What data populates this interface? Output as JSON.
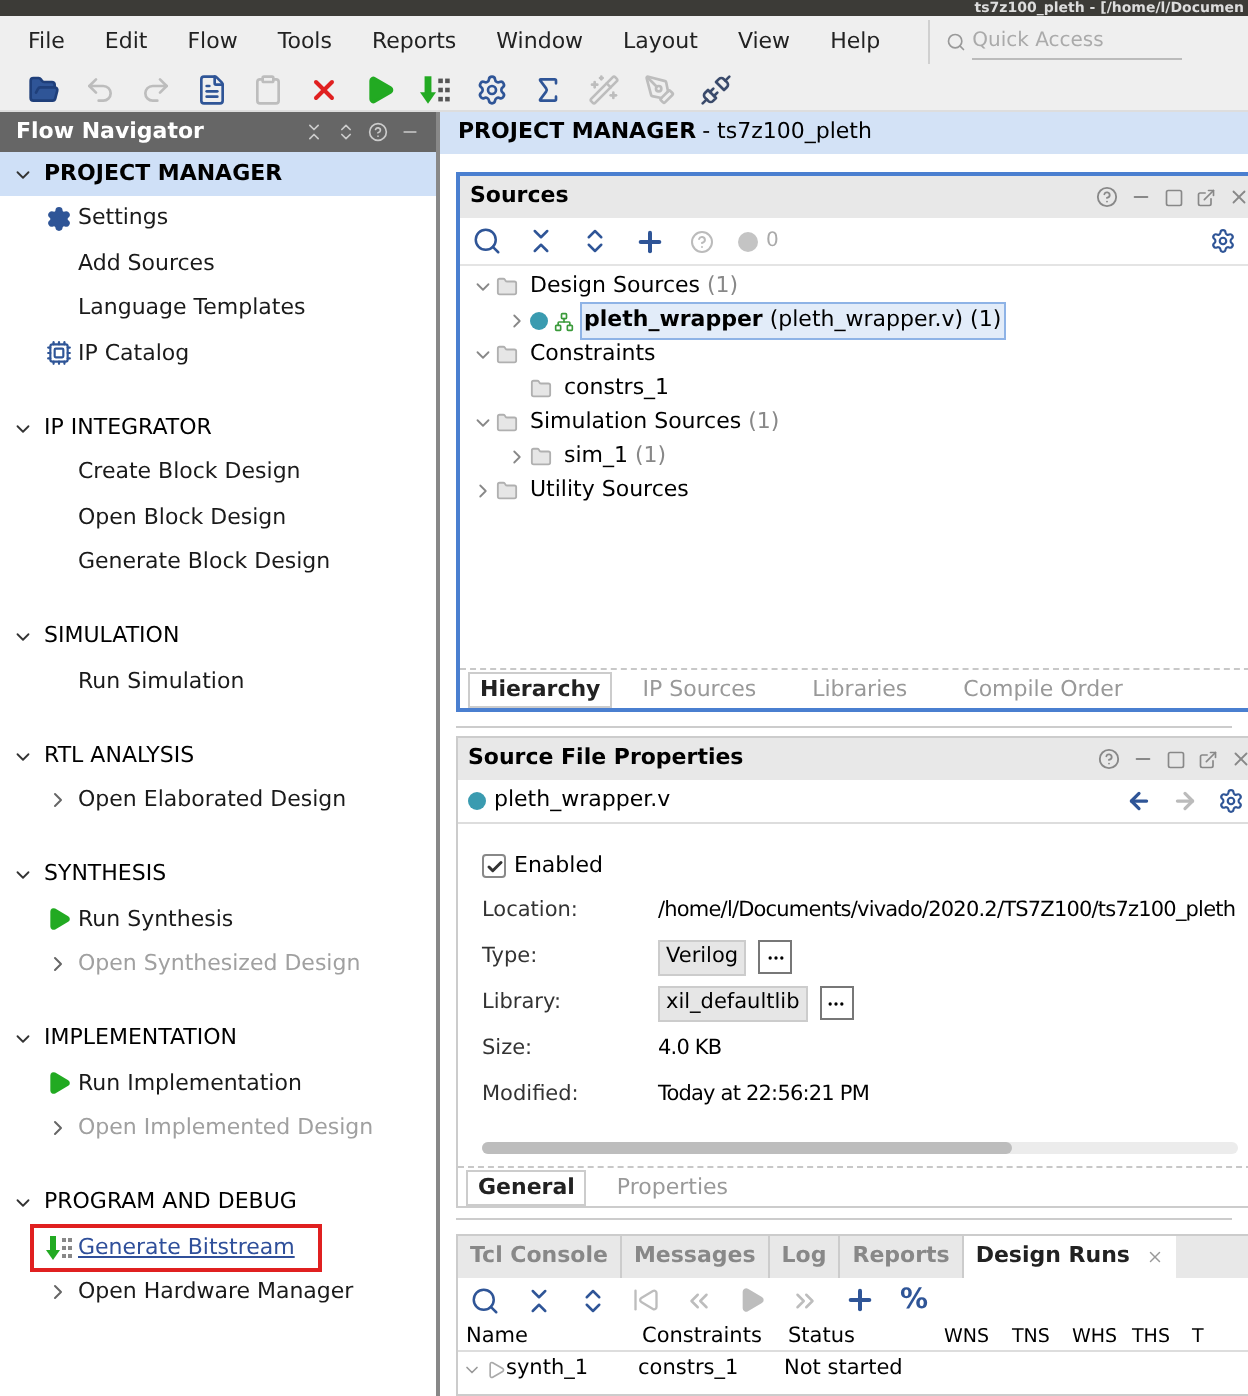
{
  "window": {
    "title": "ts7z100_pleth - [/home/l/Documen"
  },
  "menu": [
    "File",
    "Edit",
    "Flow",
    "Tools",
    "Reports",
    "Window",
    "Layout",
    "View",
    "Help"
  ],
  "quick_access": {
    "placeholder": "Quick Access"
  },
  "toolbar": [
    {
      "kind": "open",
      "disabled": false
    },
    {
      "kind": "undo",
      "disabled": true
    },
    {
      "kind": "redo",
      "disabled": true
    },
    {
      "kind": "report",
      "disabled": false
    },
    {
      "kind": "paste",
      "disabled": true
    },
    {
      "kind": "cancel",
      "disabled": false
    },
    {
      "kind": "run",
      "disabled": false
    },
    {
      "kind": "bitstream",
      "disabled": false
    },
    {
      "kind": "settings",
      "disabled": false
    },
    {
      "kind": "sigma",
      "disabled": false
    },
    {
      "kind": "wand",
      "disabled": true
    },
    {
      "kind": "pen",
      "disabled": true
    },
    {
      "kind": "unplug",
      "disabled": false
    }
  ],
  "flow_navigator": {
    "title": "Flow Navigator",
    "sections": [
      {
        "title": "PROJECT MANAGER",
        "selected": true,
        "items": [
          {
            "label": "Settings",
            "kind": "gear",
            "disabled": false
          },
          {
            "label": "Add Sources",
            "kind": "plain",
            "disabled": false
          },
          {
            "label": "Language Templates",
            "kind": "plain",
            "disabled": false
          },
          {
            "label": "IP Catalog",
            "kind": "chip",
            "disabled": false
          }
        ]
      },
      {
        "title": "IP INTEGRATOR",
        "selected": false,
        "items": [
          {
            "label": "Create Block Design",
            "kind": "plain",
            "disabled": false
          },
          {
            "label": "Open Block Design",
            "kind": "plain",
            "disabled": false
          },
          {
            "label": "Generate Block Design",
            "kind": "plain",
            "disabled": false
          }
        ]
      },
      {
        "title": "SIMULATION",
        "selected": false,
        "items": [
          {
            "label": "Run Simulation",
            "kind": "plain",
            "disabled": false
          }
        ]
      },
      {
        "title": "RTL ANALYSIS",
        "selected": false,
        "items": [
          {
            "label": "Open Elaborated Design",
            "kind": "expandable",
            "disabled": false
          }
        ]
      },
      {
        "title": "SYNTHESIS",
        "selected": false,
        "items": [
          {
            "label": "Run Synthesis",
            "kind": "run",
            "disabled": false
          },
          {
            "label": "Open Synthesized Design",
            "kind": "expandable",
            "disabled": true
          }
        ]
      },
      {
        "title": "IMPLEMENTATION",
        "selected": false,
        "items": [
          {
            "label": "Run Implementation",
            "kind": "run",
            "disabled": false
          },
          {
            "label": "Open Implemented Design",
            "kind": "expandable",
            "disabled": true
          }
        ]
      },
      {
        "title": "PROGRAM AND DEBUG",
        "selected": false,
        "items": [
          {
            "label": "Generate Bitstream",
            "kind": "bitstream",
            "disabled": false,
            "highlighted": true
          },
          {
            "label": "Open Hardware Manager",
            "kind": "expandable",
            "disabled": false
          }
        ]
      }
    ]
  },
  "main_header": {
    "title": "PROJECT MANAGER",
    "subtitle": "- ts7z100_pleth"
  },
  "sources": {
    "title": "Sources",
    "status_count": "0",
    "tree": [
      {
        "label": "Design Sources",
        "count": "(1)",
        "expanded": true,
        "children": [
          {
            "label": "pleth_wrapper",
            "detail": "(pleth_wrapper.v) (1)",
            "kind": "module",
            "expanded": false,
            "selected": true
          }
        ]
      },
      {
        "label": "Constraints",
        "expanded": true,
        "children": [
          {
            "label": "constrs_1"
          }
        ]
      },
      {
        "label": "Simulation Sources",
        "count": "(1)",
        "expanded": true,
        "children": [
          {
            "label": "sim_1",
            "count": "(1)",
            "expanded": false
          }
        ]
      },
      {
        "label": "Utility Sources",
        "expanded": false
      }
    ],
    "tabs": [
      {
        "label": "Hierarchy",
        "selected": true
      },
      {
        "label": "IP Sources",
        "selected": false
      },
      {
        "label": "Libraries",
        "selected": false
      },
      {
        "label": "Compile Order",
        "selected": false
      }
    ]
  },
  "properties": {
    "title": "Source File Properties",
    "file": "pleth_wrapper.v",
    "enabled": {
      "label": "Enabled",
      "checked": true
    },
    "fields": [
      {
        "label": "Location:",
        "value": "/home/l/Documents/vivado/2020.2/TS7Z100/ts7z100_pleth",
        "kind": "text"
      },
      {
        "label": "Type:",
        "value": "Verilog",
        "kind": "select"
      },
      {
        "label": "Library:",
        "value": "xil_defaultlib",
        "kind": "select"
      },
      {
        "label": "Size:",
        "value": "4.0 KB",
        "kind": "text"
      },
      {
        "label": "Modified:",
        "value": "Today at 22:56:21 PM",
        "kind": "text"
      }
    ],
    "tabs": [
      {
        "label": "General",
        "selected": true
      },
      {
        "label": "Properties",
        "selected": false
      }
    ]
  },
  "bottom": {
    "tabs": [
      {
        "label": "Tcl Console",
        "selected": false
      },
      {
        "label": "Messages",
        "selected": false
      },
      {
        "label": "Log",
        "selected": false
      },
      {
        "label": "Reports",
        "selected": false
      },
      {
        "label": "Design Runs",
        "selected": true
      }
    ],
    "toolbar": [
      {
        "kind": "search",
        "disabled": false
      },
      {
        "kind": "collapse",
        "disabled": false
      },
      {
        "kind": "expand",
        "disabled": false
      },
      {
        "kind": "first",
        "disabled": true
      },
      {
        "kind": "rewind",
        "disabled": true
      },
      {
        "kind": "play",
        "disabled": true
      },
      {
        "kind": "forward",
        "disabled": true
      },
      {
        "kind": "add",
        "disabled": false
      },
      {
        "kind": "percent",
        "text": "%",
        "disabled": false
      }
    ],
    "table": {
      "columns": [
        "Name",
        "Constraints",
        "Status",
        "WNS",
        "TNS",
        "WHS",
        "THS",
        "T"
      ],
      "rows": [
        {
          "expanded": true,
          "cells": [
            "synth_1",
            "constrs_1",
            "Not started",
            "",
            "",
            "",
            "",
            ""
          ]
        }
      ]
    }
  }
}
